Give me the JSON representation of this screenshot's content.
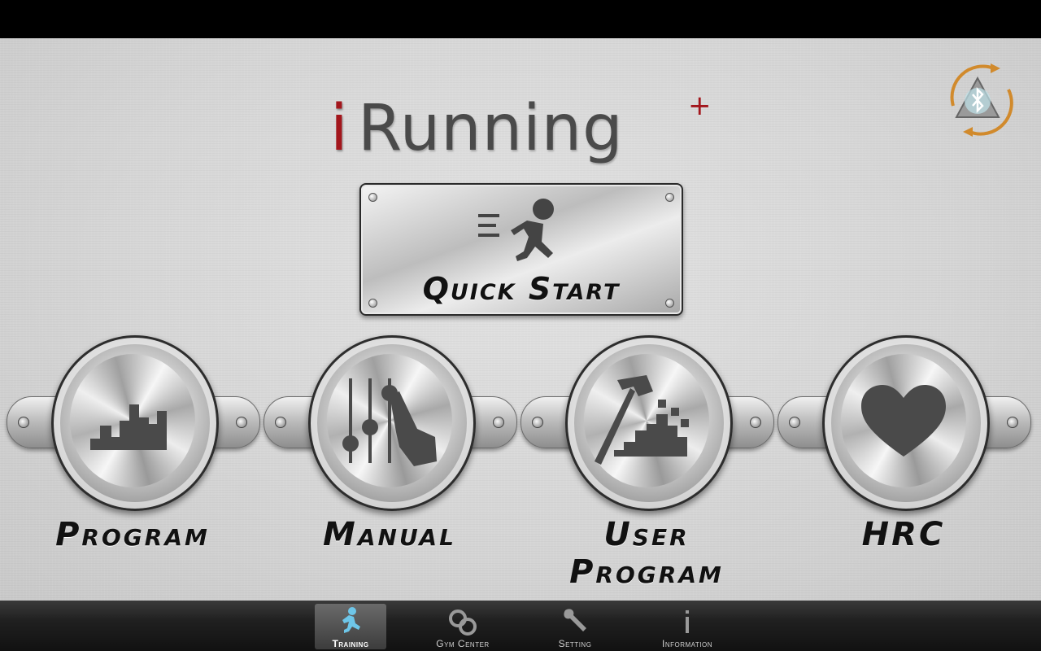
{
  "app": {
    "logo_prefix": "i",
    "logo_word": "Running",
    "logo_suffix": "+"
  },
  "quick_start": {
    "label": "Quick Start"
  },
  "modes": [
    {
      "label": "Program"
    },
    {
      "label": "Manual"
    },
    {
      "label": "User Program"
    },
    {
      "label": "HRC"
    }
  ],
  "tabs": [
    {
      "label": "Training",
      "icon": "runner-icon",
      "active": true
    },
    {
      "label": "Gym Center",
      "icon": "chain-link-icon",
      "active": false
    },
    {
      "label": "Setting",
      "icon": "wrench-icon",
      "active": false
    },
    {
      "label": "Information",
      "icon": "info-icon",
      "active": false
    }
  ],
  "colors": {
    "brand_red": "#a3161c",
    "bluetooth_accent": "#d18a2c",
    "active_runner": "#6ec6e8"
  },
  "icons": {
    "bluetooth": "bluetooth-sync-icon"
  }
}
